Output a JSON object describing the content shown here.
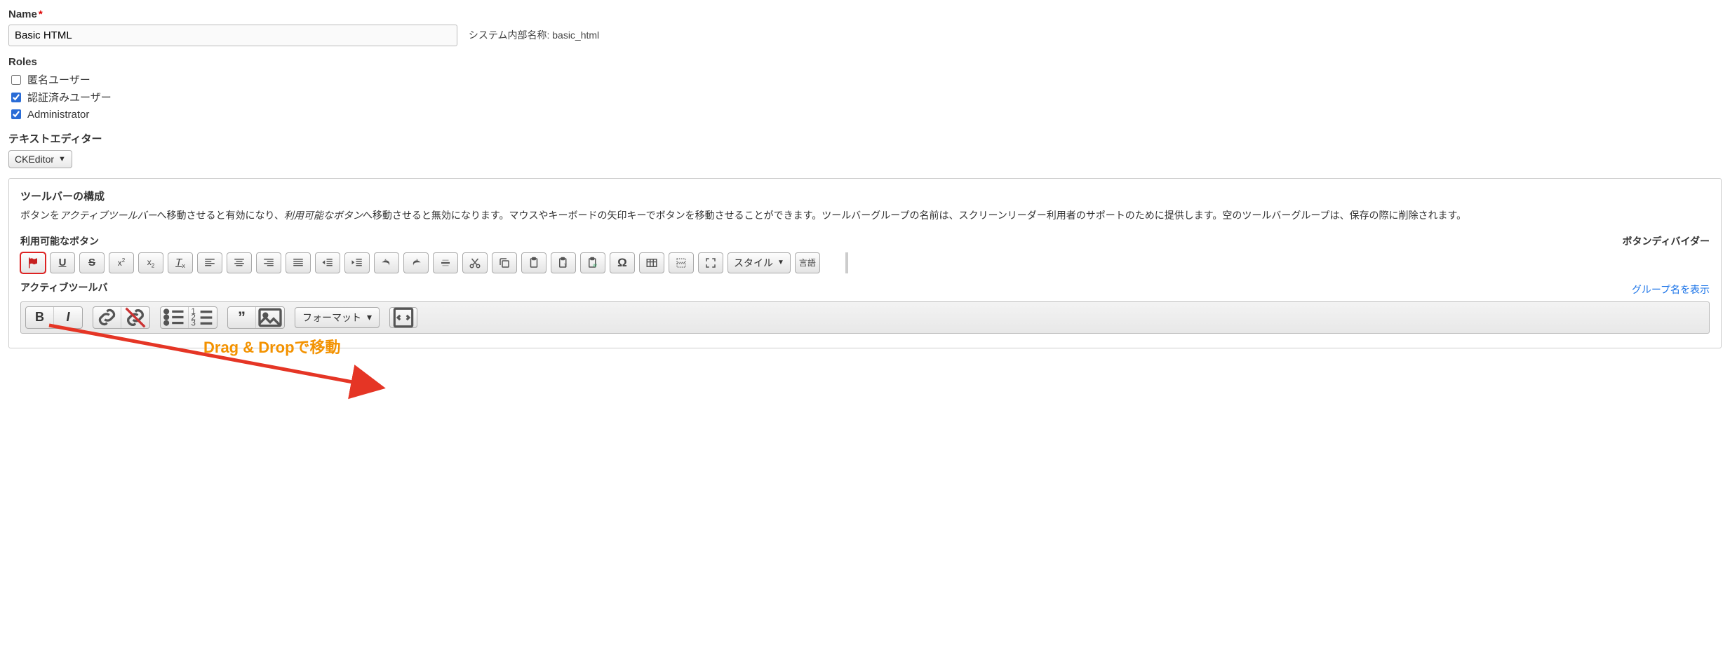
{
  "name_field": {
    "label": "Name",
    "value": "Basic HTML",
    "suffix": "システム内部名称: basic_html"
  },
  "roles": {
    "label": "Roles",
    "items": [
      {
        "label": "匿名ユーザー",
        "checked": false
      },
      {
        "label": "認証済みユーザー",
        "checked": true
      },
      {
        "label": "Administrator",
        "checked": true
      }
    ]
  },
  "text_editor": {
    "label": "テキストエディター",
    "value": "CKEditor"
  },
  "toolbar_config": {
    "title": "ツールバーの構成",
    "description_parts": {
      "p1": "ボタンを",
      "active": "アクティブツールバー",
      "p2": "へ移動させると有効になり、",
      "available": "利用可能なボタン",
      "p3": "へ移動させると無効になります。マウスやキーボードの矢印キーでボタンを移動させることができます。ツールバーグループの名前は、スクリーンリーダー利用者のサポートのために提供します。空のツールバーグループは、保存の際に削除されます。"
    },
    "available_label": "利用可能なボタン",
    "divider_label": "ボタンディバイダー",
    "active_label": "アクティブツールバ",
    "show_groups_link": "グループ名を表示",
    "style_button": "スタイル",
    "format_button": "フォーマット",
    "language_button": "言語"
  },
  "annotation": {
    "text": "Drag & Dropで移動"
  }
}
